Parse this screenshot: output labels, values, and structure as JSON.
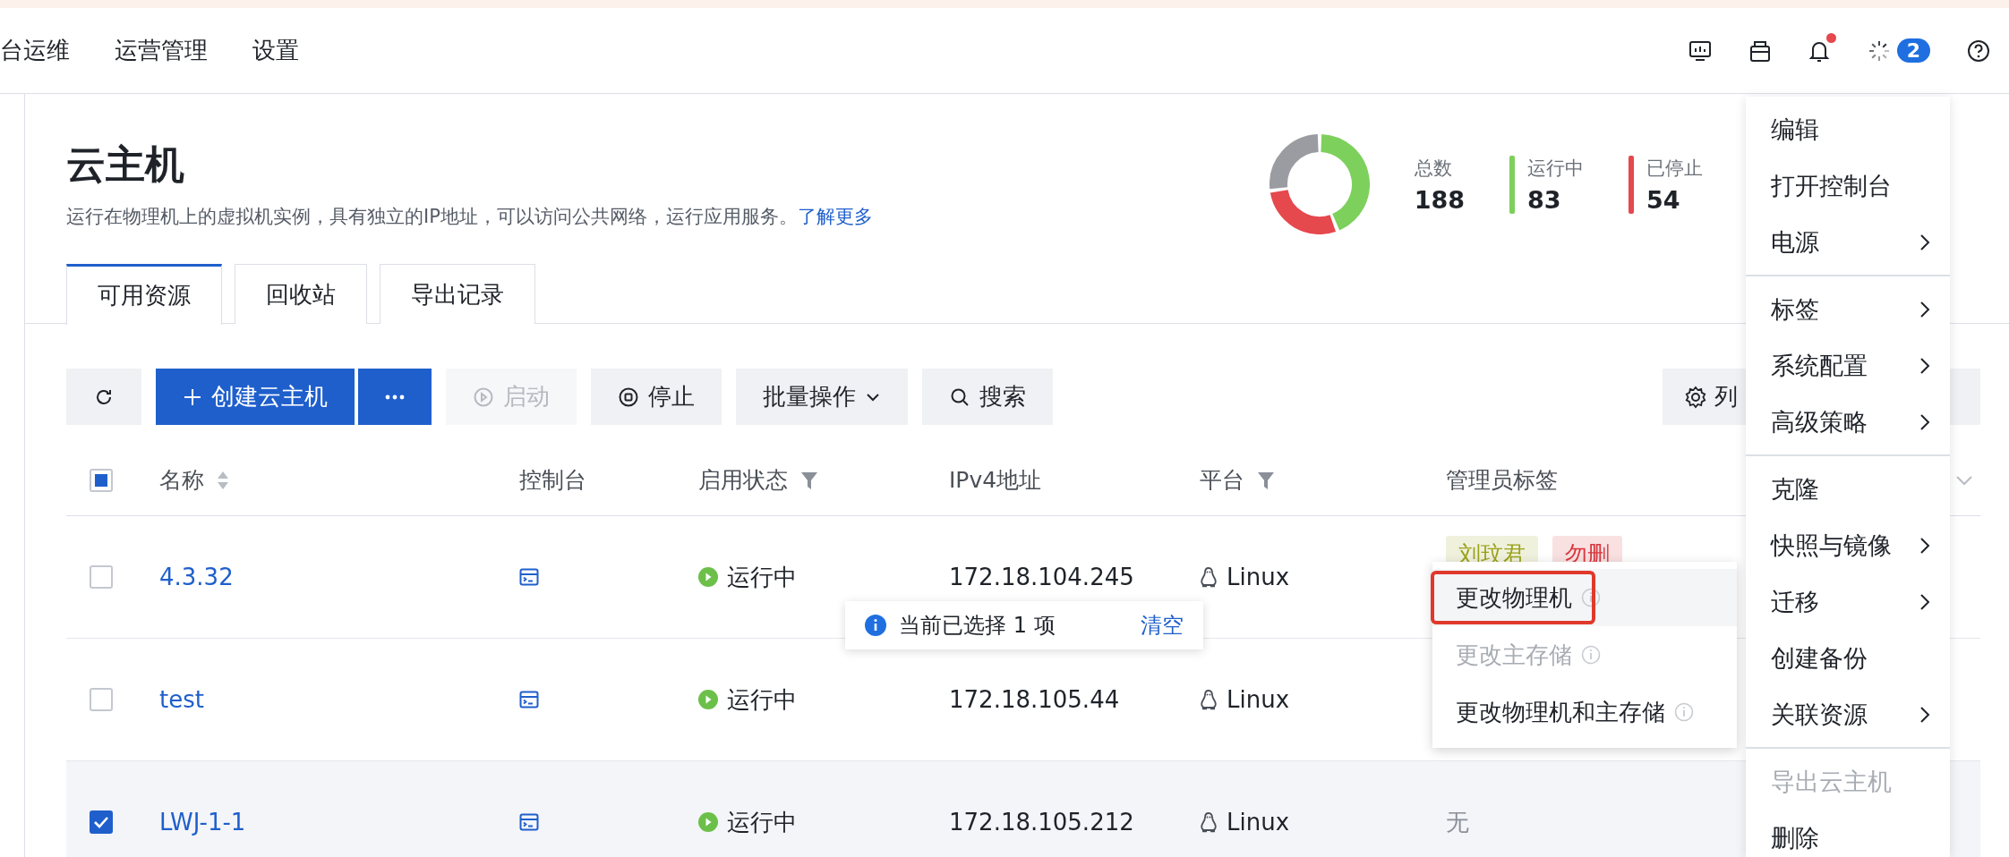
{
  "top_nav": {
    "items": [
      {
        "label": "台运维",
        "selected": false
      },
      {
        "label": "运营管理",
        "selected": false
      },
      {
        "label": "设置",
        "selected": false
      }
    ],
    "bell_alert": true,
    "task_count": "2"
  },
  "header": {
    "title": "云主机",
    "description": "运行在物理机上的虚拟机实例，具有独立的IP地址，可以访问公共网络，运行应用服务。",
    "learn_more": "了解更多"
  },
  "stats": {
    "total": {
      "label": "总数",
      "value": "188"
    },
    "items": [
      {
        "label": "运行中",
        "value": "83",
        "color": "#7ed05c"
      },
      {
        "label": "已停止",
        "value": "54",
        "color": "#e5484d"
      }
    ]
  },
  "tabs": [
    {
      "label": "可用资源",
      "selected": true
    },
    {
      "label": "回收站",
      "selected": false
    },
    {
      "label": "导出记录",
      "selected": false
    }
  ],
  "toolbar": [
    {
      "kind": "refresh",
      "disabled": false
    },
    {
      "kind": "create",
      "label": "创建云主机",
      "disabled": false
    },
    {
      "kind": "more",
      "disabled": false
    },
    {
      "kind": "start",
      "label": "启动",
      "disabled": true
    },
    {
      "kind": "stop",
      "label": "停止",
      "disabled": false
    },
    {
      "kind": "dropdown",
      "label": "批量操作",
      "disabled": false
    },
    {
      "kind": "search",
      "label": "搜索",
      "disabled": false
    },
    {
      "kind": "spacer"
    },
    {
      "kind": "columns",
      "label": "列",
      "disabled": false
    }
  ],
  "table": {
    "select_all": {
      "checked": false,
      "indeterminate": true
    },
    "columns": [
      {
        "label": "名称",
        "kind": "sort"
      },
      {
        "label": "控制台",
        "kind": "plain"
      },
      {
        "label": "启用状态",
        "kind": "filter"
      },
      {
        "label": "IPv4地址",
        "kind": "plain"
      },
      {
        "label": "平台",
        "kind": "filter"
      },
      {
        "label": "管理员标签",
        "kind": "expand"
      }
    ],
    "rows": [
      {
        "checked": false,
        "name": "4.3.32",
        "status": "运行中",
        "ipv4": "172.18.104.245",
        "platform": "Linux",
        "tags": [
          {
            "label": "刘玟君",
            "color": "#9aa31a"
          },
          {
            "label": "勿删",
            "color": "#d9363e"
          }
        ]
      },
      {
        "checked": false,
        "name": "test",
        "status": "运行中",
        "ipv4": "172.18.105.44",
        "platform": "Linux"
      },
      {
        "checked": true,
        "name": "LWJ-1-1",
        "status": "运行中",
        "ipv4": "172.18.105.212",
        "platform": "Linux",
        "tags_empty": "无"
      }
    ]
  },
  "selection_toast": {
    "text": "当前已选择 1 项",
    "action": "清空"
  },
  "submenu": [
    {
      "label": "更改物理机",
      "disabled": false,
      "highlighted": true
    },
    {
      "label": "更改主存储",
      "disabled": true,
      "highlighted": false
    },
    {
      "label": "更改物理机和主存储",
      "disabled": false,
      "highlighted": false
    }
  ],
  "menu": [
    [
      {
        "label": "编辑",
        "has_submenu": false,
        "disabled": false
      },
      {
        "label": "打开控制台",
        "has_submenu": false,
        "disabled": false
      },
      {
        "label": "电源",
        "has_submenu": true,
        "disabled": false
      }
    ],
    [
      {
        "label": "标签",
        "has_submenu": true,
        "disabled": false
      },
      {
        "label": "系统配置",
        "has_submenu": true,
        "disabled": false
      },
      {
        "label": "高级策略",
        "has_submenu": true,
        "disabled": false
      }
    ],
    [
      {
        "label": "克隆",
        "has_submenu": false,
        "disabled": false
      },
      {
        "label": "快照与镜像",
        "has_submenu": true,
        "disabled": false
      },
      {
        "label": "迁移",
        "has_submenu": true,
        "disabled": false
      },
      {
        "label": "创建备份",
        "has_submenu": false,
        "disabled": false
      },
      {
        "label": "关联资源",
        "has_submenu": true,
        "disabled": false
      }
    ],
    [
      {
        "label": "导出云主机",
        "has_submenu": false,
        "disabled": true
      },
      {
        "label": "删除",
        "has_submenu": false,
        "disabled": false
      }
    ]
  ]
}
